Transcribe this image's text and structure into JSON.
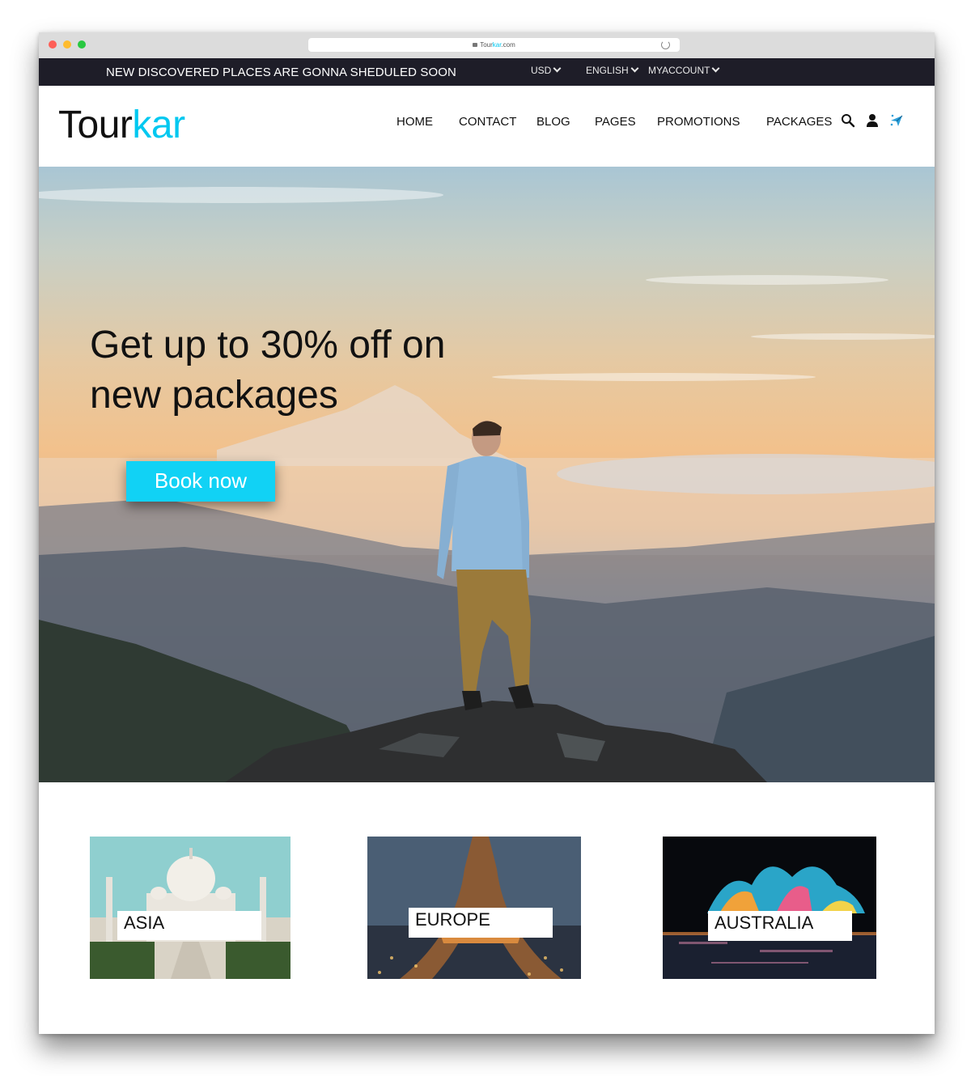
{
  "browser": {
    "url_prefix": "Tour",
    "url_accent": "kar",
    "url_suffix": ".com",
    "lock_icon": "lock-icon",
    "reload_icon": "reload-icon"
  },
  "topbar": {
    "announcement": "NEW DISCOVERED PLACES ARE GONNA SHEDULED SOON",
    "currency": "USD",
    "language": "ENGLISH",
    "account": "MYACCOUNT"
  },
  "header": {
    "logo_main": "Tour",
    "logo_accent": "kar",
    "nav": [
      "HOME",
      "CONTACT",
      "BLOG",
      "PAGES",
      "PROMOTIONS",
      "PACKAGES"
    ],
    "icons": [
      "search-icon",
      "user-icon",
      "plane-icon"
    ]
  },
  "hero": {
    "headline": "Get up to 30% off on new packages",
    "cta": "Book now"
  },
  "destinations": [
    {
      "label": "ASIA"
    },
    {
      "label": "EUROPE"
    },
    {
      "label": "AUSTRALIA"
    }
  ],
  "colors": {
    "accent": "#11d2f5",
    "topbar": "#1e1d28"
  }
}
